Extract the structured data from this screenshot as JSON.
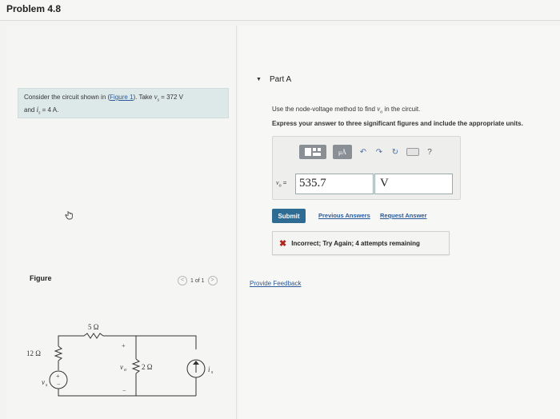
{
  "header": {
    "title": "Problem 4.8"
  },
  "problem": {
    "text_before_link": "Consider the circuit shown in (",
    "figure_link": "Figure 1",
    "text_after_link": "). Take ",
    "vs_expr": "v",
    "vs_sub": "s",
    "vs_value": " = 372 V",
    "line2_prefix": "and ",
    "is_expr": "i",
    "is_sub": "s",
    "is_value": " = 4 A."
  },
  "figure": {
    "label": "Figure",
    "pager_text": "1 of 1",
    "prev_glyph": "<",
    "next_glyph": ">",
    "circuit": {
      "r1": "5 Ω",
      "r2": "12 Ω",
      "r3": "2 Ω",
      "vo_label": "v",
      "vo_sub": "o",
      "vs_label": "v",
      "vs_sub": "s",
      "is_label": "i",
      "is_sub": "s",
      "plus": "+",
      "minus": "−"
    }
  },
  "part": {
    "caret": "▼",
    "label": "Part A",
    "instruction_prefix": "Use the node-voltage method to find ",
    "instruction_var": "v",
    "instruction_sub": "o",
    "instruction_suffix": " in the circuit.",
    "instruction_bold": "Express your answer to three significant figures and include the appropriate units."
  },
  "answer": {
    "toolbar": {
      "grid_icon": "grid-template-icon",
      "mu_label": "μÅ",
      "undo_glyph": "↶",
      "redo_glyph": "↷",
      "reset_glyph": "↻",
      "help_glyph": "?"
    },
    "var_label": "v",
    "var_sub": "o",
    "equals": " =",
    "value": "535.7",
    "unit": "V"
  },
  "actions": {
    "submit": "Submit",
    "previous_answers": "Previous Answers",
    "request_answer": "Request Answer"
  },
  "feedback": {
    "icon": "✖",
    "message": "Incorrect; Try Again; 4 attempts remaining",
    "color": "#b3261e"
  },
  "footer": {
    "provide_feedback": "Provide Feedback"
  }
}
